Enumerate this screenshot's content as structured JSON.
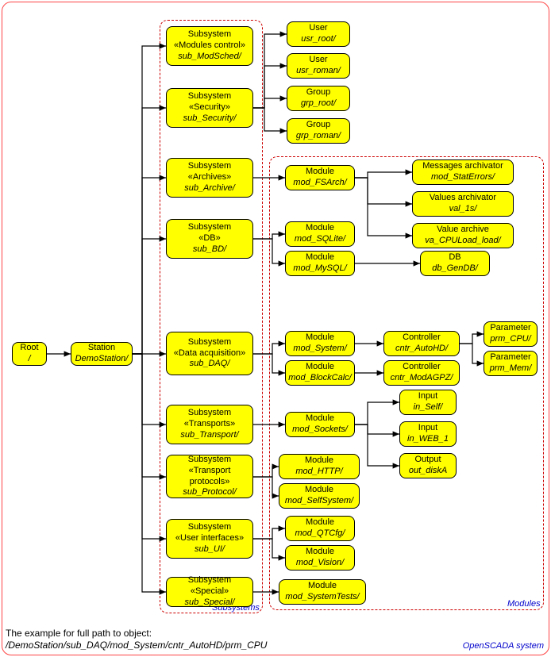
{
  "root": {
    "title": "Root",
    "path": "/"
  },
  "station": {
    "title": "Station",
    "path": "DemoStation/"
  },
  "subs": {
    "mod": {
      "title": "Subsystem\n«Modules control»",
      "path": "sub_ModSched/"
    },
    "sec": {
      "title": "Subsystem\n«Security»",
      "path": "sub_Security/"
    },
    "arch": {
      "title": "Subsystem\n«Archives»",
      "path": "sub_Archive/"
    },
    "db": {
      "title": "Subsystem\n«DB»",
      "path": "sub_BD/"
    },
    "daq": {
      "title": "Subsystem\n«Data acquisition»",
      "path": "sub_DAQ/"
    },
    "trans": {
      "title": "Subsystem\n«Transports»",
      "path": "sub_Transport/"
    },
    "prot": {
      "title": "Subsystem\n«Transport protocols»",
      "path": "sub_Protocol/"
    },
    "ui": {
      "title": "Subsystem\n«User interfaces»",
      "path": "sub_UI/"
    },
    "spec": {
      "title": "Subsystem\n«Special»",
      "path": "sub_Special/"
    }
  },
  "sec_children": {
    "u1": {
      "title": "User",
      "path": "usr_root/"
    },
    "u2": {
      "title": "User",
      "path": "usr_roman/"
    },
    "g1": {
      "title": "Group",
      "path": "grp_root/"
    },
    "g2": {
      "title": "Group",
      "path": "grp_roman/"
    }
  },
  "mods": {
    "fsarch": {
      "title": "Module",
      "path": "mod_FSArch/"
    },
    "sqlite": {
      "title": "Module",
      "path": "mod_SQLite/"
    },
    "mysql": {
      "title": "Module",
      "path": "mod_MySQL/"
    },
    "system": {
      "title": "Module",
      "path": "mod_System/"
    },
    "block": {
      "title": "Module",
      "path": "mod_BlockCalc/"
    },
    "sockets": {
      "title": "Module",
      "path": "mod_Sockets/"
    },
    "http": {
      "title": "Module",
      "path": "mod_HTTP/"
    },
    "selfsys": {
      "title": "Module",
      "path": "mod_SelfSystem/"
    },
    "qtcfg": {
      "title": "Module",
      "path": "mod_QTCfg/"
    },
    "vision": {
      "title": "Module",
      "path": "mod_Vision/"
    },
    "systests": {
      "title": "Module",
      "path": "mod_SystemTests/"
    }
  },
  "fsarch_children": {
    "m": {
      "title": "Messages archivator",
      "path": "mod_StatErrors/"
    },
    "v": {
      "title": "Values archivator",
      "path": "val_1s/"
    },
    "a": {
      "title": "Value archive",
      "path": "va_CPULoad_load/"
    }
  },
  "mysql_child": {
    "title": "DB",
    "path": "db_GenDB/"
  },
  "ctrl": {
    "auto": {
      "title": "Controller",
      "path": "cntr_AutoHD/"
    },
    "agpz": {
      "title": "Controller",
      "path": "cntr_ModAGPZ/"
    }
  },
  "params": {
    "cpu": {
      "title": "Parameter",
      "path": "prm_CPU/"
    },
    "mem": {
      "title": "Parameter",
      "path": "prm_Mem/"
    }
  },
  "io": {
    "self": {
      "title": "Input",
      "path": "in_Self/"
    },
    "web": {
      "title": "Input",
      "path": "in_WEB_1"
    },
    "disk": {
      "title": "Output",
      "path": "out_diskA"
    }
  },
  "labels": {
    "subsystems": "Subsystems",
    "modules": "Modules",
    "system": "OpenSCADA system"
  },
  "footer": {
    "caption": "The example for full path to object:",
    "path": "/DemoStation/sub_DAQ/mod_System/cntr_AutoHD/prm_CPU"
  }
}
